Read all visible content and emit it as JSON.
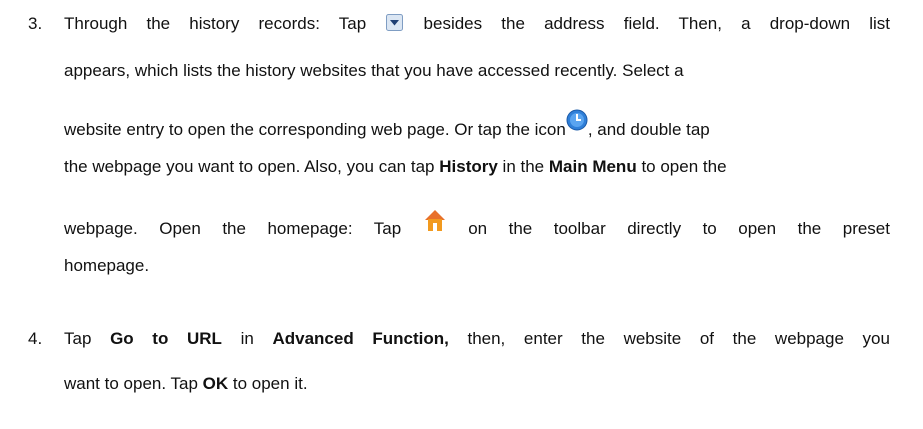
{
  "list": {
    "item3": {
      "number": "3.",
      "line1": {
        "a": "Through the history records: Tap",
        "b": "besides the address field. Then, a drop-down list"
      },
      "line2": "appears, which lists the history websites that you have accessed recently. Select a",
      "line3": {
        "a": "website entry to open the corresponding web page. Or tap the icon",
        "b": ", and double tap"
      },
      "line4": {
        "a": "the webpage you want to open. Also, you can tap",
        "bold1": "History",
        "b": "in the",
        "bold2": "Main Menu",
        "c": "to open the"
      },
      "line5": {
        "a": "webpage. Open the homepage: Tap",
        "b": "on the toolbar directly to open the preset"
      },
      "line6": "homepage."
    },
    "item4": {
      "number": "4.",
      "line1": {
        "a": "Tap",
        "bold1": "Go to URL",
        "b": "in",
        "bold2": "Advanced Function,",
        "c": "then, enter the website of the webpage you"
      },
      "line2": {
        "a": "want to open. Tap",
        "bold1": "OK",
        "b": "to open it."
      }
    }
  },
  "icons": {
    "dropdown": "dropdown-arrow-icon",
    "history": "history-clock-icon",
    "home": "home-icon"
  },
  "colors": {
    "text": "#111111",
    "dropdown_bg": "#dbe6f3",
    "dropdown_arrow": "#1f3f73",
    "history_blue": "#2f7fd8",
    "home_orange": "#f29a1e"
  }
}
